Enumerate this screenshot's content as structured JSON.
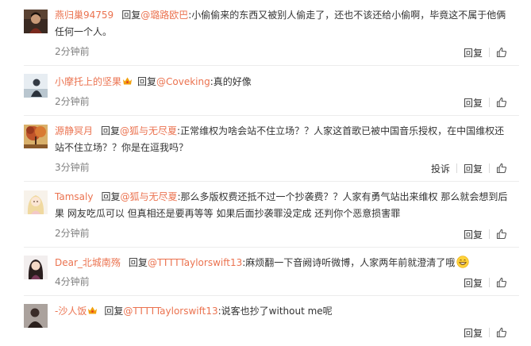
{
  "comments": [
    {
      "username": "燕归巢94759",
      "reply_label": "回复",
      "mention": "@璐路欧巴",
      "text": ":小偷偷来的东西又被别人偷走了，还也不该还给小偷啊，毕竟这不属于他俩任何一个人。",
      "time": "2分钟前",
      "actions": [
        "回复"
      ],
      "avatar_icon": "avatar-portrait-dark"
    },
    {
      "username": "小摩托上的坚果",
      "badge_icon": "crown-badge-icon",
      "reply_label": "回复",
      "mention": "@Coveking",
      "text": ":真的好像",
      "time": "2分钟前",
      "actions": [
        "回复"
      ],
      "avatar_icon": "avatar-person-silhouette"
    },
    {
      "username": "源静冥月",
      "reply_label": "回复",
      "mention": "@狐与无尽夏",
      "text": ":正常维权为啥会站不住立场？？人家这首歌已被中国音乐授权，在中国维权还站不住立场？？你是在逗我吗？",
      "time": "3分钟前",
      "actions": [
        "投诉",
        "回复"
      ],
      "avatar_icon": "avatar-autumn-tree"
    },
    {
      "username": "Tamsaly",
      "reply_label": "回复",
      "mention": "@狐与无尽夏",
      "text": ":那么多版权费还抵不过一个抄袭费？？人家有勇气站出来维权 那么就会想到后果 网友吃瓜可以 但真相还是要再等等 如果后面抄袭罪没定成 还判你个恶意损害罪",
      "time": "2分钟前",
      "actions": [
        "回复"
      ],
      "avatar_icon": "avatar-anime-girl"
    },
    {
      "username": "Dear_北城南殇",
      "reply_label": "回复",
      "mention": "@TTTTTaylorswift13",
      "text": ":麻烦翻一下音阙诗听微博，人家两年前就澄清了哦",
      "emoji_icon": "grin-emoji-icon",
      "time": "4分钟前",
      "actions": [
        "回复"
      ],
      "avatar_icon": "avatar-girl-dark-hair"
    },
    {
      "username": "-沙人饭",
      "badge_icon": "crown-badge-icon",
      "reply_label": "回复",
      "mention": "@TTTTTaylorswift13",
      "text": ":说客也抄了without me呢",
      "time": "",
      "actions": [
        "回复"
      ],
      "avatar_icon": "avatar-dark-figure"
    }
  ],
  "colors": {
    "username": "#eb7350",
    "text": "#333333",
    "time": "#808080",
    "divider": "#ececec"
  }
}
